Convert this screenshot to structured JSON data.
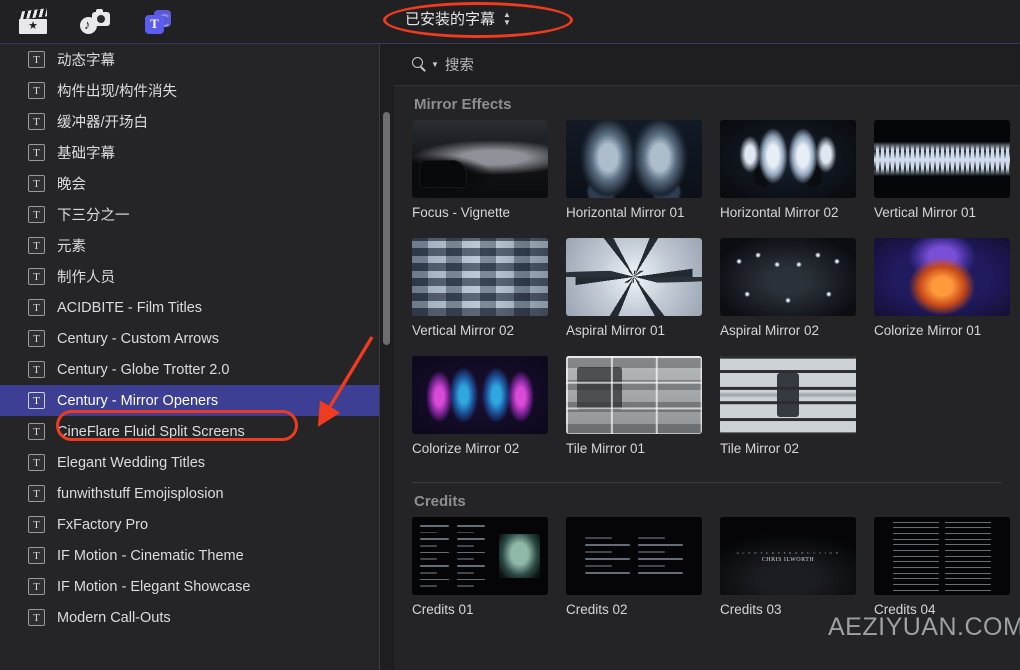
{
  "toolbar": {
    "icons": [
      {
        "name": "clapper-star-icon",
        "label": "Video"
      },
      {
        "name": "photos-audio-icon",
        "label": "Photos and Audio"
      },
      {
        "name": "titles-generators-icon",
        "label": "Titles and Generators"
      }
    ],
    "dropdown_label": "已安装的字幕"
  },
  "sidebar": {
    "items": [
      {
        "label": "动态字幕",
        "selected": false
      },
      {
        "label": "构件出现/构件消失",
        "selected": false
      },
      {
        "label": "缓冲器/开场白",
        "selected": false
      },
      {
        "label": "基础字幕",
        "selected": false
      },
      {
        "label": "晚会",
        "selected": false
      },
      {
        "label": "下三分之一",
        "selected": false
      },
      {
        "label": "元素",
        "selected": false
      },
      {
        "label": "制作人员",
        "selected": false
      },
      {
        "label": "ACIDBITE - Film Titles",
        "selected": false
      },
      {
        "label": "Century - Custom Arrows",
        "selected": false
      },
      {
        "label": "Century - Globe Trotter 2.0",
        "selected": false
      },
      {
        "label": "Century - Mirror Openers",
        "selected": true
      },
      {
        "label": "CineFlare Fluid Split Screens",
        "selected": false
      },
      {
        "label": "Elegant Wedding Titles",
        "selected": false
      },
      {
        "label": "funwithstuff Emojisplosion",
        "selected": false
      },
      {
        "label": "FxFactory Pro",
        "selected": false
      },
      {
        "label": "IF Motion - Cinematic Theme",
        "selected": false
      },
      {
        "label": "IF Motion - Elegant Showcase",
        "selected": false
      },
      {
        "label": "Modern Call-Outs",
        "selected": false
      }
    ],
    "item_icon": "T"
  },
  "search": {
    "placeholder": "搜索",
    "value": "",
    "icon": "search-icon"
  },
  "sections": [
    {
      "title": "Mirror Effects",
      "items": [
        {
          "label": "Focus - Vignette",
          "art": "a-car"
        },
        {
          "label": "Horizontal Mirror 01",
          "art": "a-face"
        },
        {
          "label": "Horizontal Mirror 02",
          "art": "a-face2"
        },
        {
          "label": "Vertical Mirror 01",
          "art": "a-city"
        },
        {
          "label": "Vertical Mirror 02",
          "art": "a-vert2"
        },
        {
          "label": "Aspiral Mirror 01",
          "art": "a-aspiral"
        },
        {
          "label": "Aspiral Mirror 02",
          "art": "a-lights"
        },
        {
          "label": "Colorize Mirror 01",
          "art": "a-colorize1"
        },
        {
          "label": "Colorize Mirror 02",
          "art": "a-colorize2"
        },
        {
          "label": "Tile Mirror 01",
          "art": "a-tile"
        },
        {
          "label": "Tile Mirror 02",
          "art": "a-tile2"
        }
      ]
    },
    {
      "title": "Credits",
      "items": [
        {
          "label": "Credits 01",
          "art": "cr1"
        },
        {
          "label": "Credits 02",
          "art": "cr2"
        },
        {
          "label": "Credits 03",
          "art": "cr3",
          "text": "CHRIS ILWORTH",
          "kicker": "A C E N T U R Y  P R O D U C T I O N"
        },
        {
          "label": "Credits 04",
          "art": "cr4"
        }
      ]
    }
  ],
  "watermark": {
    "text": "AEZIYUAN.COM"
  },
  "annotations": {
    "accent_color": "#ef3b1f",
    "ellipse_toolbar_target": "已安装的字幕",
    "ellipse_row_target": "Century - Mirror Openers",
    "arrow_points_to": "Century - Mirror Openers"
  },
  "colors": {
    "selection_blue": "#3c3f93",
    "panel_bg": "#242426",
    "sidebar_bg": "#252527",
    "toolbar_bg": "#212123"
  }
}
